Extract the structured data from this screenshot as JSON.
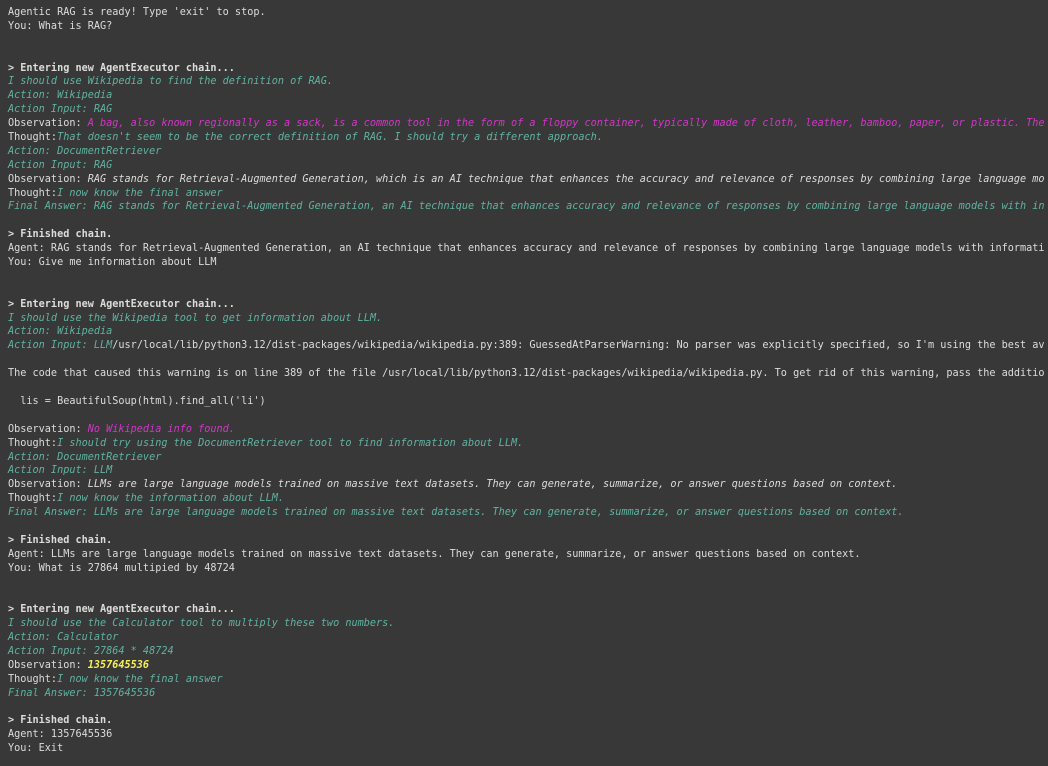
{
  "theme": {
    "background": "#383838",
    "default": "#dcdcdc",
    "green": "#5fb3a1",
    "magenta": "#d236c8",
    "yellow": "#f5f05a"
  },
  "lines": [
    {
      "segments": [
        {
          "text": "Agentic RAG is ready! Type 'exit' to stop.",
          "style": "default"
        }
      ]
    },
    {
      "segments": [
        {
          "text": "You: What is RAG?",
          "style": "default"
        }
      ]
    },
    {
      "segments": []
    },
    {
      "segments": []
    },
    {
      "segments": [
        {
          "text": "> Entering new AgentExecutor chain...",
          "style": "bold"
        }
      ]
    },
    {
      "segments": [
        {
          "text": "I should use Wikipedia to find the definition of RAG.",
          "style": "green-italic"
        }
      ]
    },
    {
      "segments": [
        {
          "text": "Action: Wikipedia",
          "style": "green-italic"
        }
      ]
    },
    {
      "segments": [
        {
          "text": "Action Input: RAG",
          "style": "green-italic"
        }
      ]
    },
    {
      "segments": [
        {
          "text": "Observation: ",
          "style": "default"
        },
        {
          "text": "A bag, also known regionally as a sack, is a common tool in the form of a floppy container, typically made of cloth, leather, bamboo, paper, or plastic. The",
          "style": "magenta-italic"
        }
      ]
    },
    {
      "segments": [
        {
          "text": "Thought:",
          "style": "default"
        },
        {
          "text": "That doesn't seem to be the correct definition of RAG. I should try a different approach.",
          "style": "green-italic"
        }
      ]
    },
    {
      "segments": [
        {
          "text": "Action: DocumentRetriever",
          "style": "green-italic"
        }
      ]
    },
    {
      "segments": [
        {
          "text": "Action Input: RAG",
          "style": "green-italic"
        }
      ]
    },
    {
      "segments": [
        {
          "text": "Observation: ",
          "style": "default"
        },
        {
          "text": "RAG stands for Retrieval-Augmented Generation, which is an AI technique that enhances the accuracy and relevance of responses by combining large language mo",
          "style": "default-italic"
        }
      ]
    },
    {
      "segments": [
        {
          "text": "Thought:",
          "style": "default"
        },
        {
          "text": "I now know the final answer",
          "style": "green-italic"
        }
      ]
    },
    {
      "segments": [
        {
          "text": "Final Answer: RAG stands for Retrieval-Augmented Generation, an AI technique that enhances accuracy and relevance of responses by combining large language models with in",
          "style": "green-italic"
        }
      ]
    },
    {
      "segments": []
    },
    {
      "segments": [
        {
          "text": "> Finished chain.",
          "style": "bold"
        }
      ]
    },
    {
      "segments": [
        {
          "text": "Agent: RAG stands for Retrieval-Augmented Generation, an AI technique that enhances accuracy and relevance of responses by combining large language models with informati",
          "style": "default"
        }
      ]
    },
    {
      "segments": [
        {
          "text": "You: Give me information about LLM",
          "style": "default"
        }
      ]
    },
    {
      "segments": []
    },
    {
      "segments": []
    },
    {
      "segments": [
        {
          "text": "> Entering new AgentExecutor chain...",
          "style": "bold"
        }
      ]
    },
    {
      "segments": [
        {
          "text": "I should use the Wikipedia tool to get information about LLM.",
          "style": "green-italic"
        }
      ]
    },
    {
      "segments": [
        {
          "text": "Action: Wikipedia",
          "style": "green-italic"
        }
      ]
    },
    {
      "segments": [
        {
          "text": "Action Input: LLM",
          "style": "green-italic"
        },
        {
          "text": "/usr/local/lib/python3.12/dist-packages/wikipedia/wikipedia.py:389: GuessedAtParserWarning: No parser was explicitly specified, so I'm using the best av",
          "style": "default"
        }
      ]
    },
    {
      "segments": []
    },
    {
      "segments": [
        {
          "text": "The code that caused this warning is on line 389 of the file /usr/local/lib/python3.12/dist-packages/wikipedia/wikipedia.py. To get rid of this warning, pass the additio",
          "style": "default"
        }
      ]
    },
    {
      "segments": []
    },
    {
      "segments": [
        {
          "text": "  lis = BeautifulSoup(html).find_all('li')",
          "style": "default"
        }
      ]
    },
    {
      "segments": []
    },
    {
      "segments": [
        {
          "text": "Observation: ",
          "style": "default"
        },
        {
          "text": "No Wikipedia info found.",
          "style": "magenta-italic"
        }
      ]
    },
    {
      "segments": [
        {
          "text": "Thought:",
          "style": "default"
        },
        {
          "text": "I should try using the DocumentRetriever tool to find information about LLM.",
          "style": "green-italic"
        }
      ]
    },
    {
      "segments": [
        {
          "text": "Action: DocumentRetriever",
          "style": "green-italic"
        }
      ]
    },
    {
      "segments": [
        {
          "text": "Action Input: LLM",
          "style": "green-italic"
        }
      ]
    },
    {
      "segments": [
        {
          "text": "Observation: ",
          "style": "default"
        },
        {
          "text": "LLMs are large language models trained on massive text datasets. They can generate, summarize, or answer questions based on context.",
          "style": "default-italic"
        }
      ]
    },
    {
      "segments": [
        {
          "text": "Thought:",
          "style": "default"
        },
        {
          "text": "I now know the information about LLM.",
          "style": "green-italic"
        }
      ]
    },
    {
      "segments": [
        {
          "text": "Final Answer: LLMs are large language models trained on massive text datasets. They can generate, summarize, or answer questions based on context.",
          "style": "green-italic"
        }
      ]
    },
    {
      "segments": []
    },
    {
      "segments": [
        {
          "text": "> Finished chain.",
          "style": "bold"
        }
      ]
    },
    {
      "segments": [
        {
          "text": "Agent: LLMs are large language models trained on massive text datasets. They can generate, summarize, or answer questions based on context.",
          "style": "default"
        }
      ]
    },
    {
      "segments": [
        {
          "text": "You: What is 27864 multipied by 48724",
          "style": "default"
        }
      ]
    },
    {
      "segments": []
    },
    {
      "segments": []
    },
    {
      "segments": [
        {
          "text": "> Entering new AgentExecutor chain...",
          "style": "bold"
        }
      ]
    },
    {
      "segments": [
        {
          "text": "I should use the Calculator tool to multiply these two numbers.",
          "style": "green-italic"
        }
      ]
    },
    {
      "segments": [
        {
          "text": "Action: Calculator",
          "style": "green-italic"
        }
      ]
    },
    {
      "segments": [
        {
          "text": "Action Input: 27864 * 48724",
          "style": "green-italic"
        }
      ]
    },
    {
      "segments": [
        {
          "text": "Observation: ",
          "style": "default"
        },
        {
          "text": "1357645536",
          "style": "yellow-bold-italic"
        }
      ]
    },
    {
      "segments": [
        {
          "text": "Thought:",
          "style": "default"
        },
        {
          "text": "I now know the final answer",
          "style": "green-italic"
        }
      ]
    },
    {
      "segments": [
        {
          "text": "Final Answer: 1357645536",
          "style": "green-italic"
        }
      ]
    },
    {
      "segments": []
    },
    {
      "segments": [
        {
          "text": "> Finished chain.",
          "style": "bold"
        }
      ]
    },
    {
      "segments": [
        {
          "text": "Agent: 1357645536",
          "style": "default"
        }
      ]
    },
    {
      "segments": [
        {
          "text": "You: Exit",
          "style": "default"
        }
      ]
    }
  ]
}
